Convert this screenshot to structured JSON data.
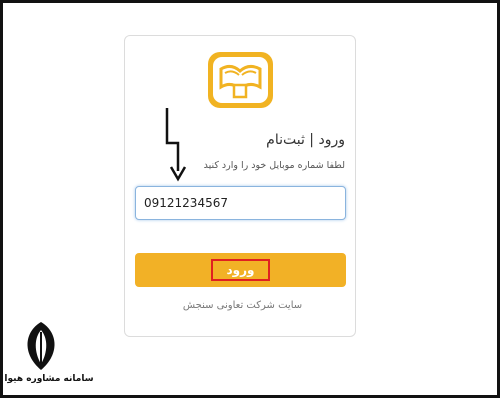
{
  "login_form": {
    "title": "ورود | ثبت‌نام",
    "instruction": "لطفا شماره موبایل خود را وارد کنید",
    "phone_value": "09121234567",
    "submit_label": "ورود",
    "footer": "سایت شرکت تعاونی سنجش"
  },
  "watermark": {
    "brand_name": "سامانه مشاوره هیوا",
    "logo_icon": "feather-pen-icon"
  },
  "colors": {
    "accent": "#f2b126",
    "highlight_box": "#e02020",
    "input_focus": "#8ab4de"
  },
  "logo": {
    "icon": "open-book-icon"
  },
  "annotation": {
    "icon": "down-arrow-icon"
  }
}
